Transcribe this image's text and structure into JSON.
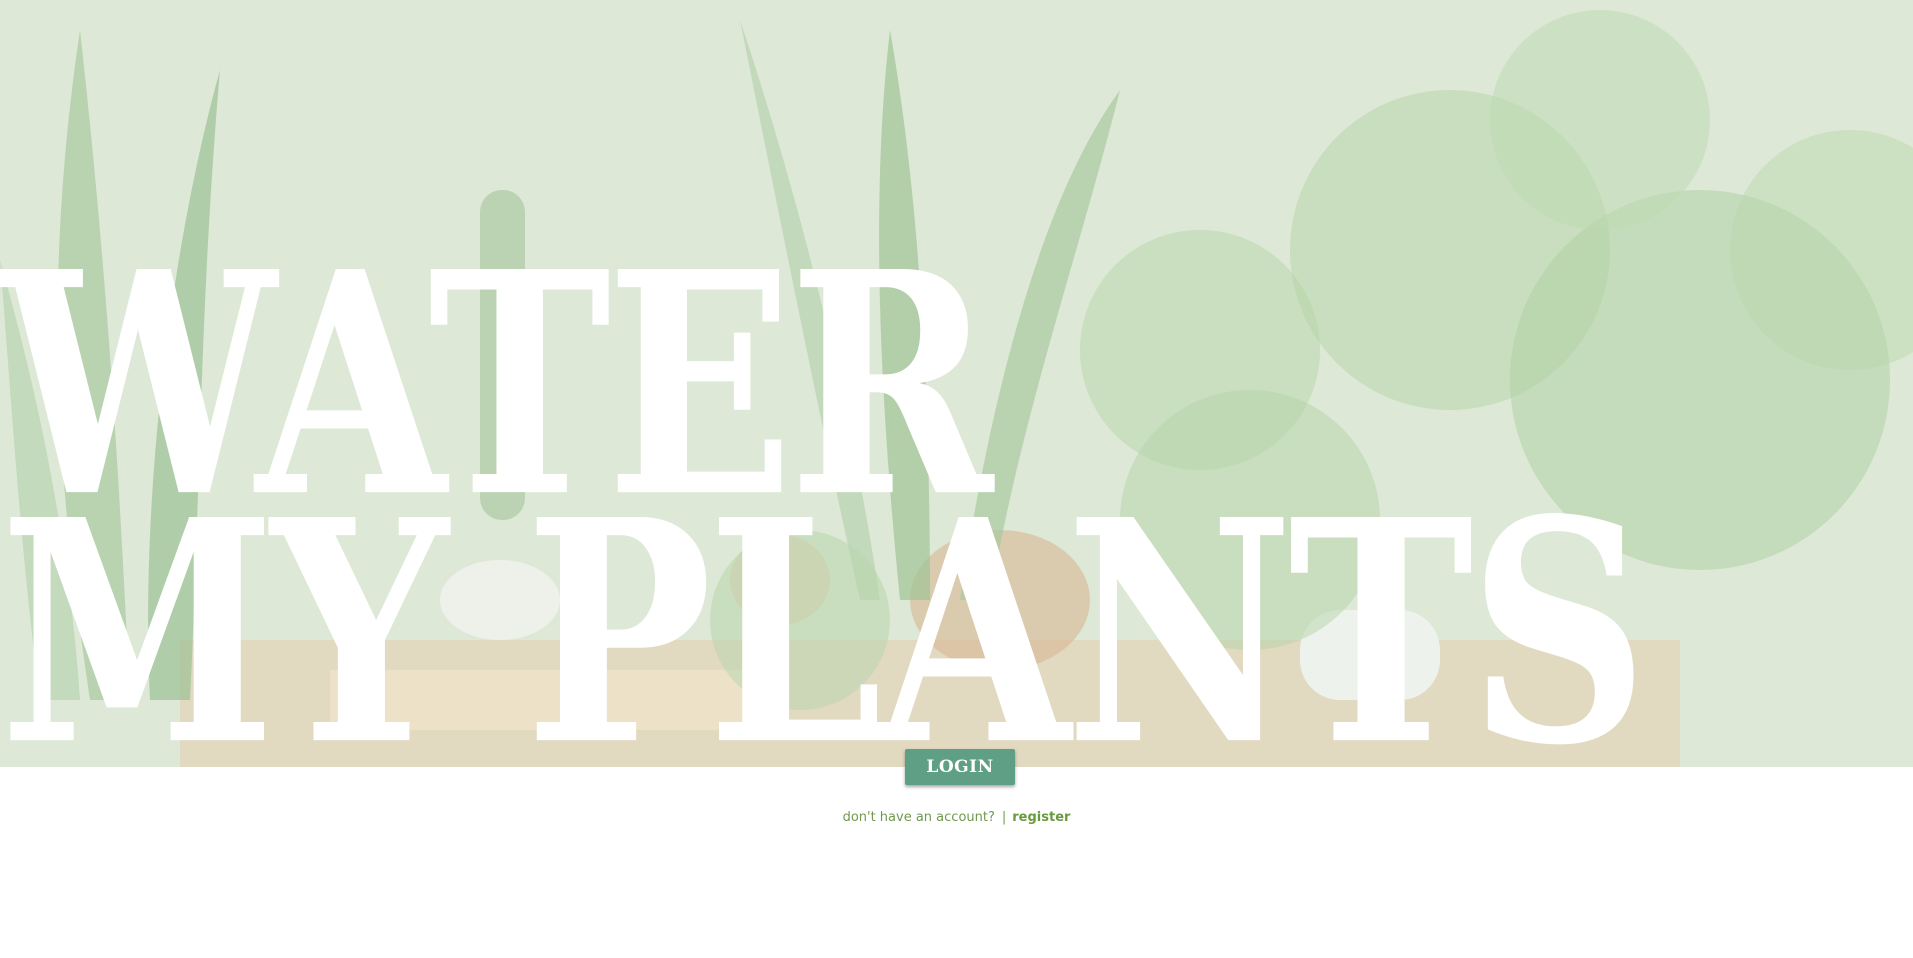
{
  "headline": {
    "line1": "WATER",
    "line2": "MY PLANTS"
  },
  "auth": {
    "login_label": "LOGIN",
    "prompt": "don't have an account?",
    "separator": "|",
    "register_label": "register"
  },
  "colors": {
    "hero_tint": "#dde9d6",
    "button": "#5f9f85",
    "link": "#6f9a4e"
  }
}
